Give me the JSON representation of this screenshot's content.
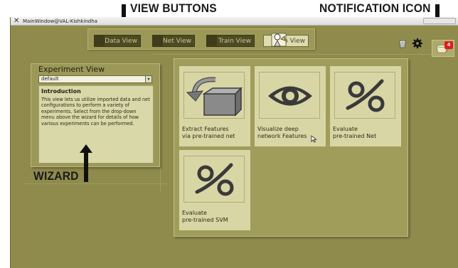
{
  "annotations": {
    "view_buttons": "VIEW BUTTONS",
    "notification_icon": "NOTIFICATION ICON",
    "wizard": "WIZARD"
  },
  "window": {
    "title": "MainWindow@VAL-Kishkindha"
  },
  "toolbar": {
    "buttons": [
      {
        "label": "Data View"
      },
      {
        "label": "Net View"
      },
      {
        "label": "Train View"
      },
      {
        "label": "Exp View"
      }
    ],
    "active": "Exp View"
  },
  "notification": {
    "count": "4"
  },
  "experiment_panel": {
    "title": "Experiment View",
    "selected": "default",
    "intro_heading": "Introduction",
    "intro_text": "This view lets us utilize imported data and net configurations to perform a variety of experiments. Select from the drop-down menu above the wizard for details of how various experiments can be performed."
  },
  "cards": [
    {
      "label_line1": "Extract  Features",
      "label_line2": "via pre-trained net",
      "icon": "box-arrow-icon"
    },
    {
      "label_line1": "Visualize deep",
      "label_line2": "network Features",
      "icon": "eye-icon"
    },
    {
      "label_line1": "Evaluate",
      "label_line2": "pre-trained Net",
      "icon": "percent-icon"
    },
    {
      "label_line1": "Evaluate",
      "label_line2": "pre-trained SVM",
      "icon": "percent-icon"
    }
  ],
  "colors": {
    "background": "#8f8b4d",
    "panel": "#9c9858",
    "card": "#d8d6a5",
    "badge": "#e31b1b"
  }
}
